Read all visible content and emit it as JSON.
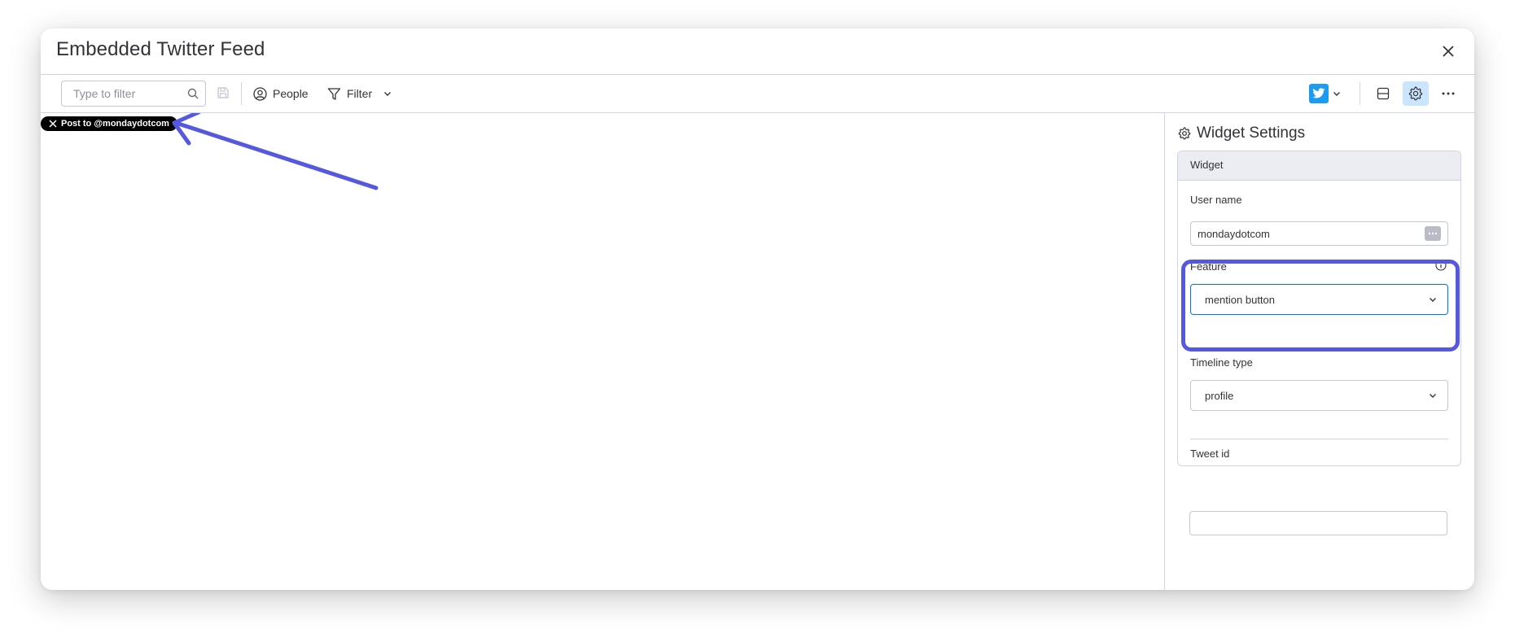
{
  "window": {
    "title": "Embedded Twitter Feed"
  },
  "toolbar": {
    "search_placeholder": "Type to filter",
    "people_label": "People",
    "filter_label": "Filter"
  },
  "canvas": {
    "mention_button_label": "Post to @mondaydotcom"
  },
  "settings": {
    "title": "Widget Settings",
    "section_title": "Widget",
    "user_name_label": "User name",
    "user_name_value": "mondaydotcom",
    "feature_label": "Feature",
    "feature_value": "mention button",
    "timeline_type_label": "Timeline type",
    "timeline_type_value": "profile",
    "tweet_id_label": "Tweet id",
    "tweet_id_value": ""
  },
  "colors": {
    "annotation": "#5559df",
    "twitter_blue": "#1d9bf0",
    "active_tool_bg": "#cce5ff"
  },
  "icons": [
    "close-icon",
    "search-icon",
    "save-icon",
    "people-icon",
    "filter-icon",
    "chevron-down-icon",
    "twitter-icon",
    "layout-icon",
    "gear-icon",
    "more-icon",
    "x-logo-icon",
    "info-icon",
    "dots-icon"
  ]
}
